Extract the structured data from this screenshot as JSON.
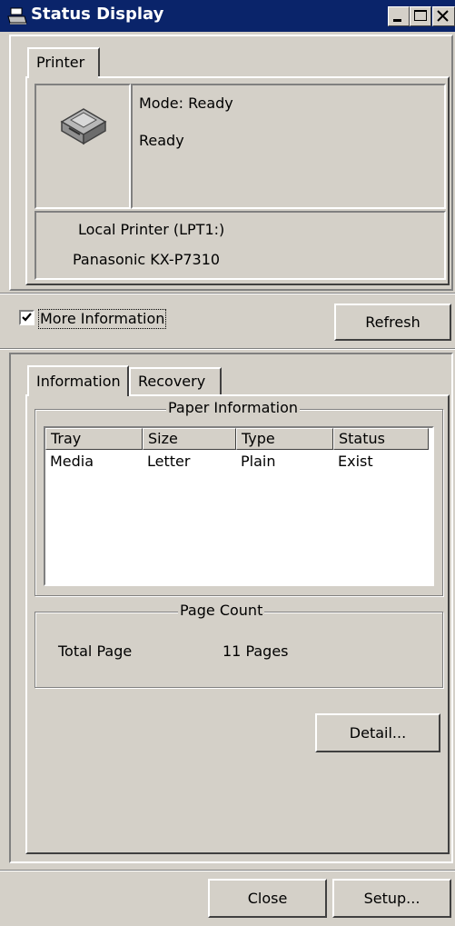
{
  "window": {
    "title": "Status Display"
  },
  "printer_tab": {
    "label": "Printer"
  },
  "status": {
    "mode": "Mode: Ready",
    "state": "Ready"
  },
  "printer_info": {
    "port": "Local Printer (LPT1:)",
    "model": "Panasonic KX-P7310"
  },
  "more_info": {
    "label": "More Information",
    "checked": true
  },
  "buttons": {
    "refresh": "Refresh",
    "detail": "Detail...",
    "close": "Close",
    "setup": "Setup..."
  },
  "tabs": [
    {
      "label": "Information"
    },
    {
      "label": "Recovery"
    }
  ],
  "paper_info": {
    "title": "Paper Information",
    "columns": [
      "Tray",
      "Size",
      "Type",
      "Status"
    ],
    "rows": [
      [
        "Media",
        "Letter",
        "Plain",
        "Exist"
      ]
    ]
  },
  "page_count": {
    "title": "Page Count",
    "label": "Total Page",
    "value": "11 Pages"
  }
}
